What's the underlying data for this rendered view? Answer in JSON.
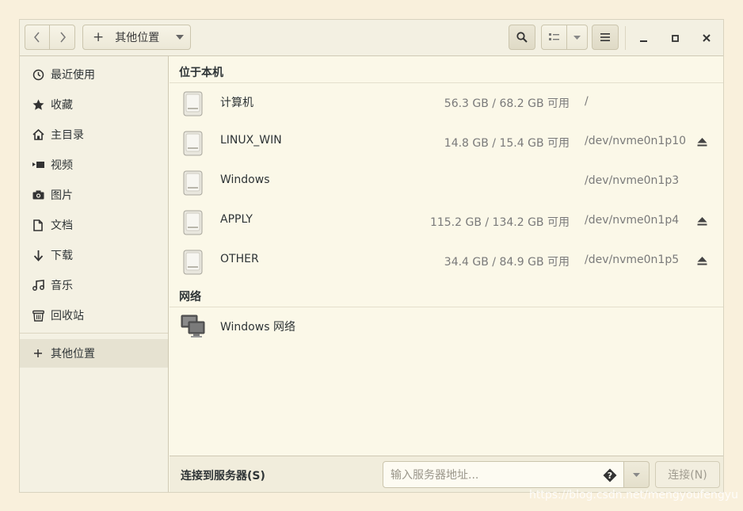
{
  "header": {
    "path_label": "其他位置"
  },
  "sidebar": {
    "items": [
      {
        "label": "最近使用",
        "icon": "clock-icon"
      },
      {
        "label": "收藏",
        "icon": "star-icon"
      },
      {
        "label": "主目录",
        "icon": "home-icon"
      },
      {
        "label": "视频",
        "icon": "video-icon"
      },
      {
        "label": "图片",
        "icon": "camera-icon"
      },
      {
        "label": "文档",
        "icon": "document-icon"
      },
      {
        "label": "下载",
        "icon": "download-arrow-icon"
      },
      {
        "label": "音乐",
        "icon": "music-note-icon"
      },
      {
        "label": "回收站",
        "icon": "trash-icon"
      }
    ],
    "other": {
      "label": "其他位置",
      "icon": "plus-icon"
    }
  },
  "main": {
    "local_title": "位于本机",
    "drives": [
      {
        "name": "计算机",
        "usage": "56.3 GB / 68.2 GB 可用",
        "dev": "/",
        "eject": false
      },
      {
        "name": "LINUX_WIN",
        "usage": "14.8 GB / 15.4 GB 可用",
        "dev": "/dev/nvme0n1p10",
        "eject": true
      },
      {
        "name": "Windows",
        "usage": "",
        "dev": "/dev/nvme0n1p3",
        "eject": false
      },
      {
        "name": "APPLY",
        "usage": "115.2 GB / 134.2 GB 可用",
        "dev": "/dev/nvme0n1p4",
        "eject": true
      },
      {
        "name": "OTHER",
        "usage": "34.4 GB / 84.9 GB 可用",
        "dev": "/dev/nvme0n1p5",
        "eject": true
      }
    ],
    "network_title": "网络",
    "network_items": [
      {
        "name": "Windows 网络"
      }
    ]
  },
  "bottom": {
    "connect_label": "连接到服务器(S)",
    "server_placeholder": "输入服务器地址...",
    "connect_button": "连接(N)"
  },
  "watermark": "https://blog.csdn.net/mengyoufengyu"
}
